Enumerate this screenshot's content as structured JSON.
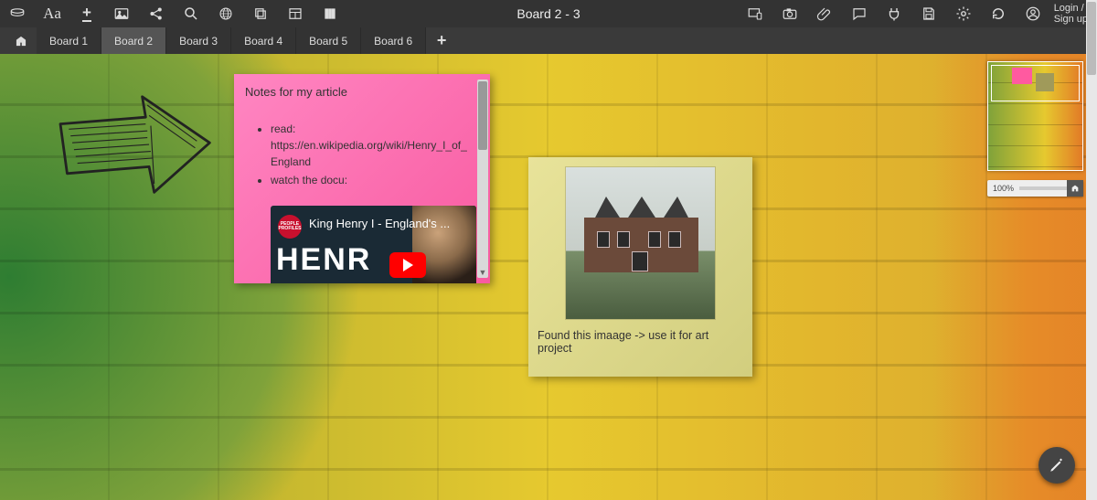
{
  "header": {
    "title": "Board 2 - 3",
    "auth": {
      "login": "Login /",
      "signup": "Sign up"
    }
  },
  "tabs": {
    "items": [
      "Board 1",
      "Board 2",
      "Board 3",
      "Board 4",
      "Board 5",
      "Board 6"
    ],
    "active_index": 1
  },
  "note_pink": {
    "title": "Notes for my article",
    "bullets": [
      "read: https://en.wikipedia.org/wiki/Henry_I_of_England",
      "watch the docu:"
    ],
    "video": {
      "channel": "PEOPLE PROFILES",
      "title": "King Henry I - England's ...",
      "big_text": "HENR"
    }
  },
  "note_yellow": {
    "caption": "Found this imaage -> use it for art project"
  },
  "zoom": {
    "label": "100%"
  }
}
